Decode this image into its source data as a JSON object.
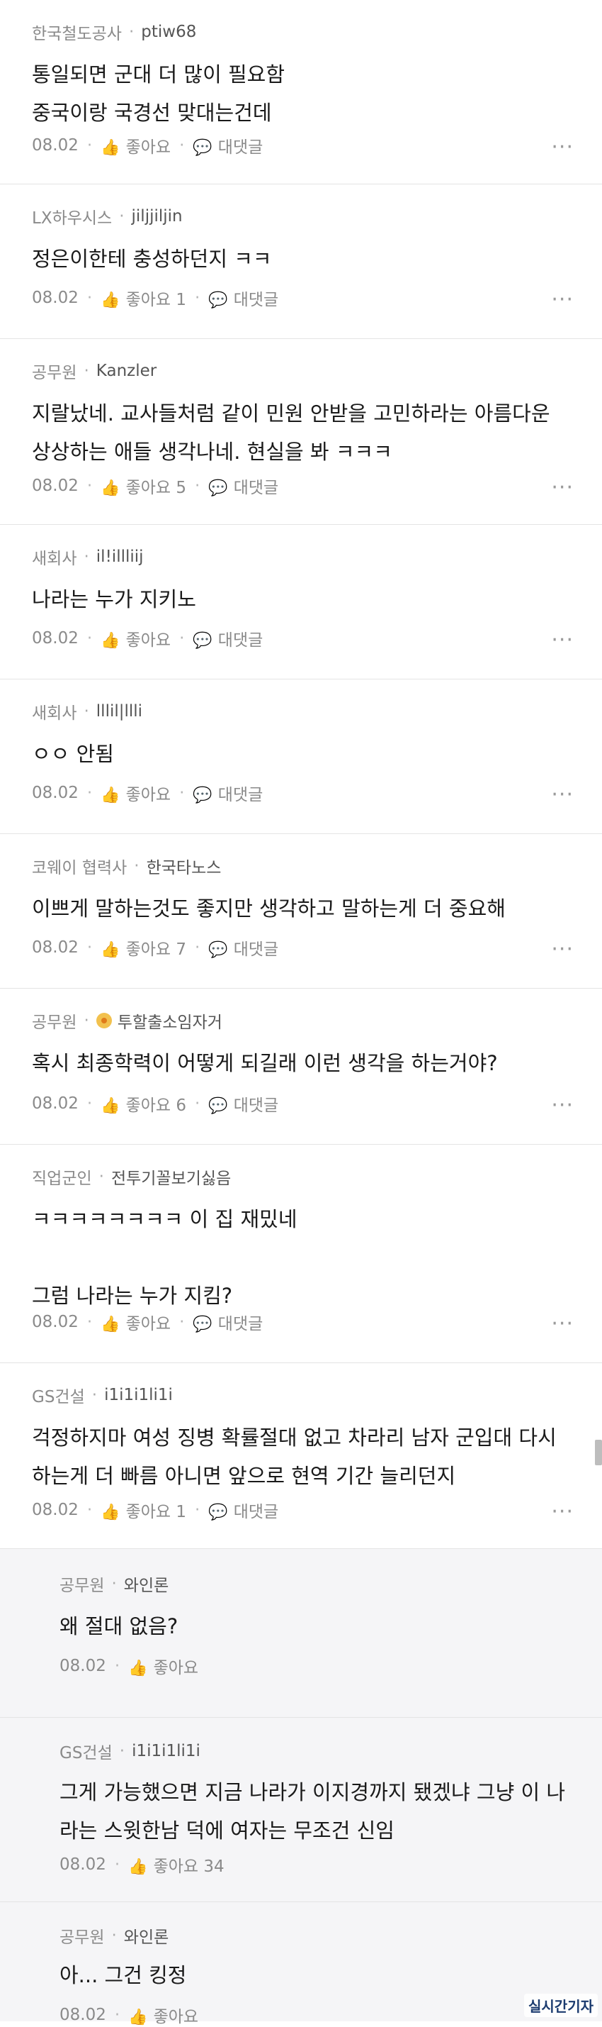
{
  "labels": {
    "like": "좋아요",
    "reply": "대댓글",
    "more": "···"
  },
  "comments": [
    {
      "company": "한국철도공사",
      "nick": "ptiw68",
      "body": "통일되면 군대 더 많이 필요함\n중국이랑 국경선 맞대는건데",
      "date": "08.02",
      "likes": ""
    },
    {
      "company": "LX하우시스",
      "nick": "jiljjiljin",
      "body": "정은이한테 충성하던지 ㅋㅋ",
      "date": "08.02",
      "likes": "1"
    },
    {
      "company": "공무원",
      "nick": "Kanzler",
      "body": "지랄났네. 교사들처럼 같이 민원 안받을 고민하라는 아름다운\n상상하는 애들 생각나네. 현실을 봐 ㅋㅋㅋ",
      "date": "08.02",
      "likes": "5"
    },
    {
      "company": "새회사",
      "nick": "il!illliij",
      "body": "나라는 누가 지키노",
      "date": "08.02",
      "likes": ""
    },
    {
      "company": "새회사",
      "nick": "lllil|llli",
      "body": "ㅇㅇ 안됨",
      "date": "08.02",
      "likes": ""
    },
    {
      "company": "코웨이 협력사",
      "nick": "한국타노스",
      "body": "이쁘게 말하는것도 좋지만 생각하고 말하는게 더 중요해",
      "date": "08.02",
      "likes": "7"
    },
    {
      "company": "공무원",
      "nick": "투할출소임자거",
      "body": "혹시 최종학력이 어떻게 되길래 이런 생각을 하는거야?",
      "date": "08.02",
      "likes": "6"
    },
    {
      "company": "직업군인",
      "nick": "전투기꼴보기싫음",
      "body": "ㅋㅋㅋㅋㅋㅋㅋㅋ 이 집 재밌네\n\n그럼 나라는 누가 지킴?",
      "date": "08.02",
      "likes": ""
    },
    {
      "company": "GS건설",
      "nick": "i1i1i1li1i",
      "body": "걱정하지마 여성 징병 확률절대 없고 차라리 남자 군입대 다시\n하는게 더 빠름 아니면 앞으로 현역 기간 늘리던지",
      "date": "08.02",
      "likes": "1"
    }
  ],
  "replies": [
    {
      "company": "공무원",
      "nick": "와인론",
      "body": "왜 절대 없음?",
      "date": "08.02",
      "likes": ""
    },
    {
      "company": "GS건설",
      "nick": "i1i1i1li1i",
      "body": "그게 가능했으면 지금 나라가 이지경까지 됐겠냐 그냥 이 나\n라는 스윗한남 덕에 여자는 무조건 신임",
      "date": "08.02",
      "likes": "34"
    },
    {
      "company": "공무원",
      "nick": "와인론",
      "body": "아... 그건 킹정",
      "date": "08.02",
      "likes": ""
    }
  ],
  "watermark": "실시간기자"
}
